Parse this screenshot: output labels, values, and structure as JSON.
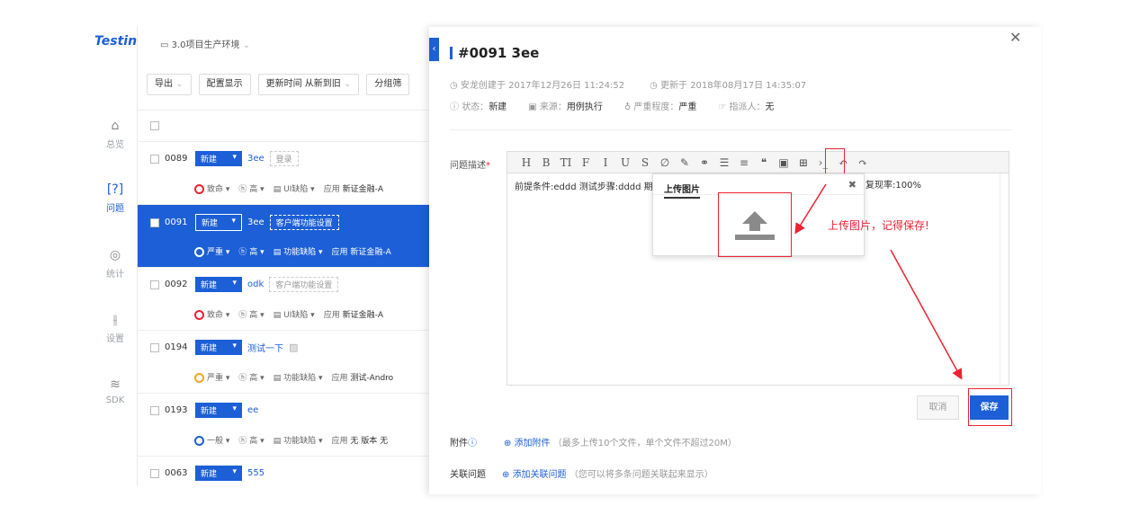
{
  "app": {
    "logo": "Testin",
    "project": "3.0项目生产环境"
  },
  "rail": [
    {
      "label": "总览",
      "icon": "home-icon"
    },
    {
      "label": "问题",
      "icon": "issue-icon"
    },
    {
      "label": "统计",
      "icon": "stats-icon"
    },
    {
      "label": "设置",
      "icon": "settings-icon"
    },
    {
      "label": "SDK",
      "icon": "layers-icon"
    }
  ],
  "toolbar": {
    "export": "导出",
    "config": "配置显示",
    "sort": "更新时间 从新到旧",
    "group": "分组筛"
  },
  "issues": [
    {
      "num": "0089",
      "status": "新建",
      "title": "3ee",
      "tag": "登录",
      "severity": "致命",
      "priority": "高",
      "type": "UI缺陷",
      "app_label": "应用",
      "app": "新证金融-A"
    },
    {
      "num": "0091",
      "status": "新建",
      "title": "3ee",
      "tag": "客户端功能设置",
      "severity": "严重",
      "priority": "高",
      "type": "功能缺陷",
      "app_label": "应用",
      "app": "新证金融-A"
    },
    {
      "num": "0092",
      "status": "新建",
      "title": "odk",
      "tag": "客户端功能设置",
      "severity": "致命",
      "priority": "高",
      "type": "UI缺陷",
      "app_label": "应用",
      "app": "新证金融-A"
    },
    {
      "num": "0194",
      "status": "新建",
      "title": "测试一下",
      "tag": "",
      "severity": "严重",
      "priority": "高",
      "type": "功能缺陷",
      "app_label": "应用",
      "app": "测试-Andro"
    },
    {
      "num": "0193",
      "status": "新建",
      "title": "ee",
      "tag": "",
      "severity": "一般",
      "priority": "高",
      "type": "功能缺陷",
      "app_label": "应用",
      "app": "无  版本 无"
    },
    {
      "num": "0063",
      "status": "新建",
      "title": "555",
      "tag": ""
    }
  ],
  "detail": {
    "title": "#0091 3ee",
    "created": "安龙创建于 2017年12月26日 11:24:52",
    "updated": "更新于 2018年08月17日 14:35:07",
    "status_label": "状态：",
    "status": "新建",
    "source_label": "来源：",
    "source": "用例执行",
    "severity_label": "严重程度：",
    "severity": "严重",
    "assignee_label": "指派人：",
    "assignee": "无",
    "desc_label": "问题描述",
    "desc_text": "前提条件:eddd 测试步骤:dddd 期",
    "desc_tail": "复现率:100%",
    "toolbar_glyphs": [
      "H",
      "B",
      "TI",
      "F",
      "I",
      "U",
      "S",
      "∅",
      "✎",
      "⚭",
      "☰",
      "≡",
      "❝",
      "▣",
      "⊞",
      "›_",
      "↶",
      "↷"
    ],
    "upload_tab": "上传图片",
    "annotation": "上传图片，记得保存!",
    "cancel": "取消",
    "save": "保存",
    "attach_label": "附件",
    "attach_link": "添加附件",
    "attach_hint": "（最多上传10个文件，单个文件不超过20M）",
    "related_label": "关联问题",
    "related_link": "添加关联问题",
    "related_hint": "（您可以将多条问题关联起来显示）"
  },
  "colors": {
    "accent": "#1c5fd6",
    "annotation": "#ee2233"
  }
}
